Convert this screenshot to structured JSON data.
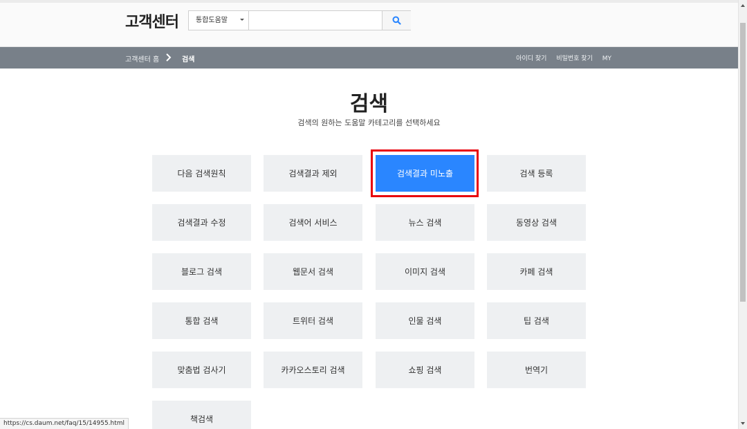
{
  "header": {
    "logo": "고객센터",
    "search": {
      "category": "통합도움말",
      "placeholder": "",
      "value": ""
    }
  },
  "navbar": {
    "breadcrumb_home": "고객센터 홈",
    "breadcrumb_current": "검색",
    "links": [
      "아이디 찾기",
      "비밀번호 찾기",
      "MY"
    ]
  },
  "main": {
    "title": "검색",
    "subtitle": "검색의 원하는 도움말 카테고리를 선택하세요",
    "categories": [
      "다음 검색원칙",
      "검색결과 제외",
      "검색결과 미노출",
      "검색 등록",
      "검색결과 수정",
      "검색어 서비스",
      "뉴스 검색",
      "동영상 검색",
      "블로그 검색",
      "웹문서 검색",
      "이미지 검색",
      "카페 검색",
      "통합 검색",
      "트위터 검색",
      "인물 검색",
      "팁 검색",
      "맞춤법 검사기",
      "카카오스토리 검색",
      "쇼핑 검색",
      "번역기",
      "책검색"
    ],
    "selected_category": "검색결과 미노출"
  },
  "status_bar": {
    "url": "https://cs.daum.net/faq/15/14955.html"
  },
  "colors": {
    "accent": "#2a86ff",
    "navbar": "#788089",
    "highlight": "#e8000b",
    "tile": "#eef0f2"
  }
}
